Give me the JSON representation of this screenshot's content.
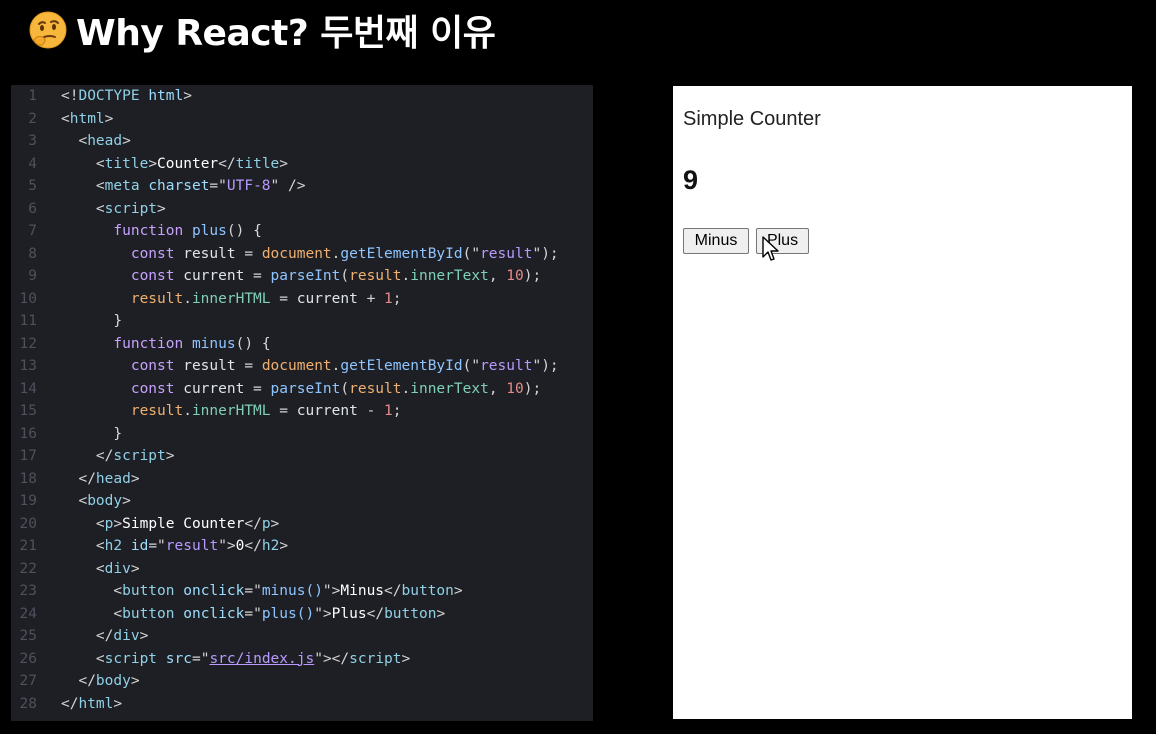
{
  "header": {
    "title": "Why React? 두번째 이유",
    "emoji_icon": "thinking-face-icon"
  },
  "code": {
    "lines": [
      {
        "n": "1",
        "tokens": [
          [
            "t-punc",
            "<!"
          ],
          [
            "t-tag",
            "DOCTYPE"
          ],
          [
            "t-punc",
            " "
          ],
          [
            "t-attr",
            "html"
          ],
          [
            "t-punc",
            ">"
          ]
        ]
      },
      {
        "n": "2",
        "tokens": [
          [
            "t-punc",
            "<"
          ],
          [
            "t-tag",
            "html"
          ],
          [
            "t-punc",
            ">"
          ]
        ]
      },
      {
        "n": "3",
        "tokens": [
          [
            "t-punc",
            "  <"
          ],
          [
            "t-tag",
            "head"
          ],
          [
            "t-punc",
            ">"
          ]
        ]
      },
      {
        "n": "4",
        "tokens": [
          [
            "t-punc",
            "    <"
          ],
          [
            "t-tag",
            "title"
          ],
          [
            "t-punc",
            ">"
          ],
          [
            "t-text",
            "Counter"
          ],
          [
            "t-punc",
            "</"
          ],
          [
            "t-tag",
            "title"
          ],
          [
            "t-punc",
            ">"
          ]
        ]
      },
      {
        "n": "5",
        "tokens": [
          [
            "t-punc",
            "    <"
          ],
          [
            "t-tag",
            "meta"
          ],
          [
            "t-punc",
            " "
          ],
          [
            "t-attr",
            "charset"
          ],
          [
            "t-punc",
            "=\""
          ],
          [
            "t-str",
            "UTF-8"
          ],
          [
            "t-punc",
            "\" />"
          ]
        ]
      },
      {
        "n": "6",
        "tokens": [
          [
            "t-punc",
            "    <"
          ],
          [
            "t-tag",
            "script"
          ],
          [
            "t-punc",
            ">"
          ]
        ]
      },
      {
        "n": "7",
        "tokens": [
          [
            "t-kw",
            "      function "
          ],
          [
            "t-fn",
            "plus"
          ],
          [
            "t-punc",
            "() "
          ],
          [
            "t-plain",
            "{"
          ]
        ]
      },
      {
        "n": "8",
        "tokens": [
          [
            "t-kw",
            "        const "
          ],
          [
            "t-var",
            "result"
          ],
          [
            "t-punc",
            " = "
          ],
          [
            "t-obj",
            "document"
          ],
          [
            "t-punc",
            "."
          ],
          [
            "t-fn",
            "getElementById"
          ],
          [
            "t-punc",
            "(\""
          ],
          [
            "t-str",
            "result"
          ],
          [
            "t-punc",
            "\");"
          ]
        ]
      },
      {
        "n": "9",
        "tokens": [
          [
            "t-kw",
            "        const "
          ],
          [
            "t-var",
            "current"
          ],
          [
            "t-punc",
            " = "
          ],
          [
            "t-fn",
            "parseInt"
          ],
          [
            "t-punc",
            "("
          ],
          [
            "t-obj",
            "result"
          ],
          [
            "t-punc",
            "."
          ],
          [
            "t-prop",
            "innerText"
          ],
          [
            "t-punc",
            ", "
          ],
          [
            "t-num",
            "10"
          ],
          [
            "t-punc",
            ");"
          ]
        ]
      },
      {
        "n": "10",
        "tokens": [
          [
            "t-obj",
            "        result"
          ],
          [
            "t-punc",
            "."
          ],
          [
            "t-prop",
            "innerHTML"
          ],
          [
            "t-punc",
            " = "
          ],
          [
            "t-var",
            "current"
          ],
          [
            "t-punc",
            " + "
          ],
          [
            "t-num",
            "1"
          ],
          [
            "t-punc",
            ";"
          ]
        ]
      },
      {
        "n": "11",
        "tokens": [
          [
            "t-plain",
            "      }"
          ]
        ]
      },
      {
        "n": "12",
        "tokens": [
          [
            "t-kw",
            "      function "
          ],
          [
            "t-fn",
            "minus"
          ],
          [
            "t-punc",
            "() "
          ],
          [
            "t-plain",
            "{"
          ]
        ]
      },
      {
        "n": "13",
        "tokens": [
          [
            "t-kw",
            "        const "
          ],
          [
            "t-var",
            "result"
          ],
          [
            "t-punc",
            " = "
          ],
          [
            "t-obj",
            "document"
          ],
          [
            "t-punc",
            "."
          ],
          [
            "t-fn",
            "getElementById"
          ],
          [
            "t-punc",
            "(\""
          ],
          [
            "t-str",
            "result"
          ],
          [
            "t-punc",
            "\");"
          ]
        ]
      },
      {
        "n": "14",
        "tokens": [
          [
            "t-kw",
            "        const "
          ],
          [
            "t-var",
            "current"
          ],
          [
            "t-punc",
            " = "
          ],
          [
            "t-fn",
            "parseInt"
          ],
          [
            "t-punc",
            "("
          ],
          [
            "t-obj",
            "result"
          ],
          [
            "t-punc",
            "."
          ],
          [
            "t-prop",
            "innerText"
          ],
          [
            "t-punc",
            ", "
          ],
          [
            "t-num",
            "10"
          ],
          [
            "t-punc",
            ");"
          ]
        ]
      },
      {
        "n": "15",
        "tokens": [
          [
            "t-obj",
            "        result"
          ],
          [
            "t-punc",
            "."
          ],
          [
            "t-prop",
            "innerHTML"
          ],
          [
            "t-punc",
            " = "
          ],
          [
            "t-var",
            "current"
          ],
          [
            "t-punc",
            " - "
          ],
          [
            "t-num",
            "1"
          ],
          [
            "t-punc",
            ";"
          ]
        ]
      },
      {
        "n": "16",
        "tokens": [
          [
            "t-plain",
            "      }"
          ]
        ]
      },
      {
        "n": "17",
        "tokens": [
          [
            "t-punc",
            "    </"
          ],
          [
            "t-tag",
            "script"
          ],
          [
            "t-punc",
            ">"
          ]
        ]
      },
      {
        "n": "18",
        "tokens": [
          [
            "t-punc",
            "  </"
          ],
          [
            "t-tag",
            "head"
          ],
          [
            "t-punc",
            ">"
          ]
        ]
      },
      {
        "n": "19",
        "tokens": [
          [
            "t-punc",
            "  <"
          ],
          [
            "t-tag",
            "body"
          ],
          [
            "t-punc",
            ">"
          ]
        ]
      },
      {
        "n": "20",
        "tokens": [
          [
            "t-punc",
            "    <"
          ],
          [
            "t-tag",
            "p"
          ],
          [
            "t-punc",
            ">"
          ],
          [
            "t-text",
            "Simple Counter"
          ],
          [
            "t-punc",
            "</"
          ],
          [
            "t-tag",
            "p"
          ],
          [
            "t-punc",
            ">"
          ]
        ]
      },
      {
        "n": "21",
        "tokens": [
          [
            "t-punc",
            "    <"
          ],
          [
            "t-tag",
            "h2"
          ],
          [
            "t-punc",
            " "
          ],
          [
            "t-attr",
            "id"
          ],
          [
            "t-punc",
            "=\""
          ],
          [
            "t-str",
            "result"
          ],
          [
            "t-punc",
            "\">"
          ],
          [
            "t-text",
            "0"
          ],
          [
            "t-punc",
            "</"
          ],
          [
            "t-tag",
            "h2"
          ],
          [
            "t-punc",
            ">"
          ]
        ]
      },
      {
        "n": "22",
        "tokens": [
          [
            "t-punc",
            "    <"
          ],
          [
            "t-tag",
            "div"
          ],
          [
            "t-punc",
            ">"
          ]
        ]
      },
      {
        "n": "23",
        "tokens": [
          [
            "t-punc",
            "      <"
          ],
          [
            "t-tag",
            "button"
          ],
          [
            "t-punc",
            " "
          ],
          [
            "t-attr",
            "onclick"
          ],
          [
            "t-punc",
            "=\""
          ],
          [
            "t-fn",
            "minus()"
          ],
          [
            "t-punc",
            "\">"
          ],
          [
            "t-text",
            "Minus"
          ],
          [
            "t-punc",
            "</"
          ],
          [
            "t-tag",
            "button"
          ],
          [
            "t-punc",
            ">"
          ]
        ]
      },
      {
        "n": "24",
        "tokens": [
          [
            "t-punc",
            "      <"
          ],
          [
            "t-tag",
            "button"
          ],
          [
            "t-punc",
            " "
          ],
          [
            "t-attr",
            "onclick"
          ],
          [
            "t-punc",
            "=\""
          ],
          [
            "t-fn",
            "plus()"
          ],
          [
            "t-punc",
            "\">"
          ],
          [
            "t-text",
            "Plus"
          ],
          [
            "t-punc",
            "</"
          ],
          [
            "t-tag",
            "button"
          ],
          [
            "t-punc",
            ">"
          ]
        ]
      },
      {
        "n": "25",
        "tokens": [
          [
            "t-punc",
            "    </"
          ],
          [
            "t-tag",
            "div"
          ],
          [
            "t-punc",
            ">"
          ]
        ]
      },
      {
        "n": "26",
        "tokens": [
          [
            "t-punc",
            "    <"
          ],
          [
            "t-tag",
            "script"
          ],
          [
            "t-punc",
            " "
          ],
          [
            "t-attr",
            "src"
          ],
          [
            "t-punc",
            "=\""
          ],
          [
            "t-link",
            "src/index.js"
          ],
          [
            "t-punc",
            "\"></"
          ],
          [
            "t-tag",
            "script"
          ],
          [
            "t-punc",
            ">"
          ]
        ]
      },
      {
        "n": "27",
        "tokens": [
          [
            "t-punc",
            "  </"
          ],
          [
            "t-tag",
            "body"
          ],
          [
            "t-punc",
            ">"
          ]
        ]
      },
      {
        "n": "28",
        "tokens": [
          [
            "t-punc",
            "</"
          ],
          [
            "t-tag",
            "html"
          ],
          [
            "t-punc",
            ">"
          ]
        ]
      }
    ]
  },
  "preview": {
    "paragraph": "Simple Counter",
    "counter_value": "9",
    "minus_label": "Minus",
    "plus_label": "Plus",
    "cursor_icon": "mouse-pointer-icon"
  }
}
